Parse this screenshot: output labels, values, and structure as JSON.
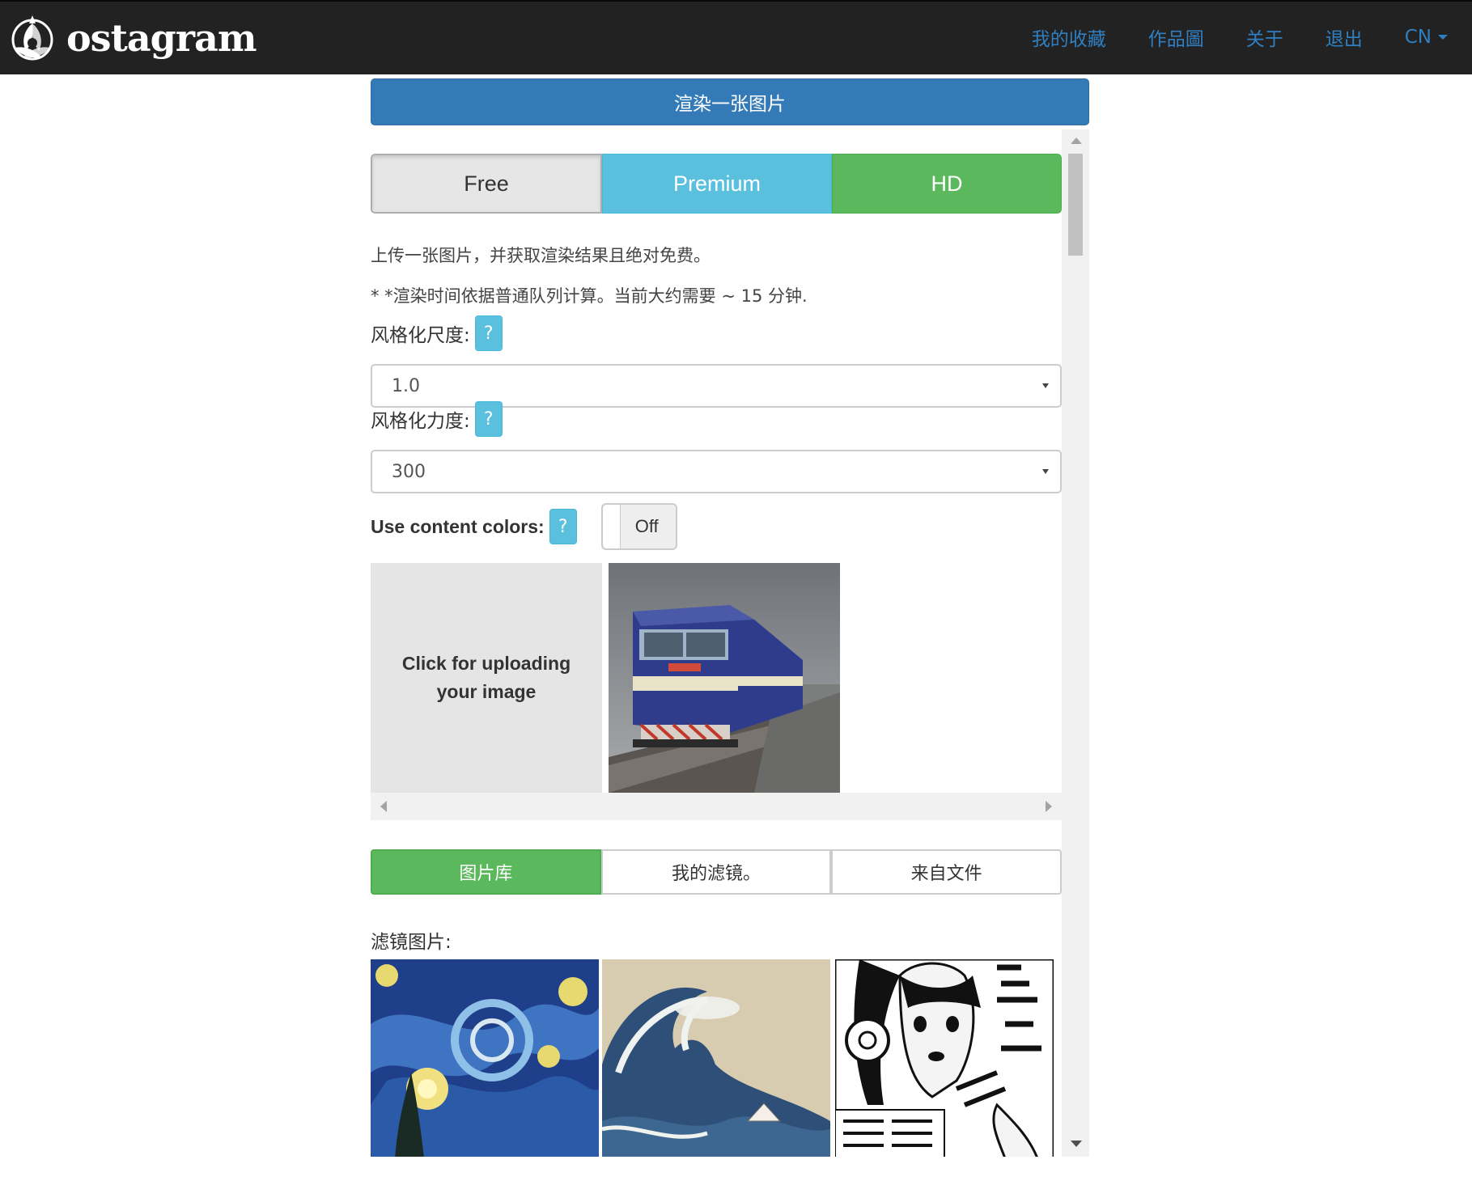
{
  "navbar": {
    "brand": "ostagram",
    "links": [
      {
        "label": "我的收藏"
      },
      {
        "label": "作品圖"
      },
      {
        "label": "关于"
      },
      {
        "label": "退出"
      },
      {
        "label": "CN"
      }
    ]
  },
  "render_button": "渲染一张图片",
  "plans": {
    "free": "Free",
    "premium": "Premium",
    "hd": "HD"
  },
  "info": {
    "line1": "上传一张图片，并获取渲染结果且绝对免费。",
    "line2": "* *渲染时间依据普通队列计算。当前大约需要 ~ 15 分钟."
  },
  "stylization_scale": {
    "label": "风格化尺度:",
    "help": "?",
    "value": "1.0"
  },
  "stylization_strength": {
    "label": "风格化力度:",
    "help": "?",
    "value": "300"
  },
  "content_colors": {
    "label": "Use content colors:",
    "help": "?",
    "toggle": "Off"
  },
  "upload": {
    "text": "Click for uploading your image"
  },
  "source_tabs": [
    {
      "label": "图片库"
    },
    {
      "label": "我的滤镜。"
    },
    {
      "label": "来自文件"
    }
  ],
  "filters": {
    "title": "滤镜图片:"
  },
  "colors": {
    "navbar": "#222222",
    "link": "#2f7fc1",
    "primary": "#337ab7",
    "info": "#5bc0de",
    "success": "#5cb85c"
  }
}
